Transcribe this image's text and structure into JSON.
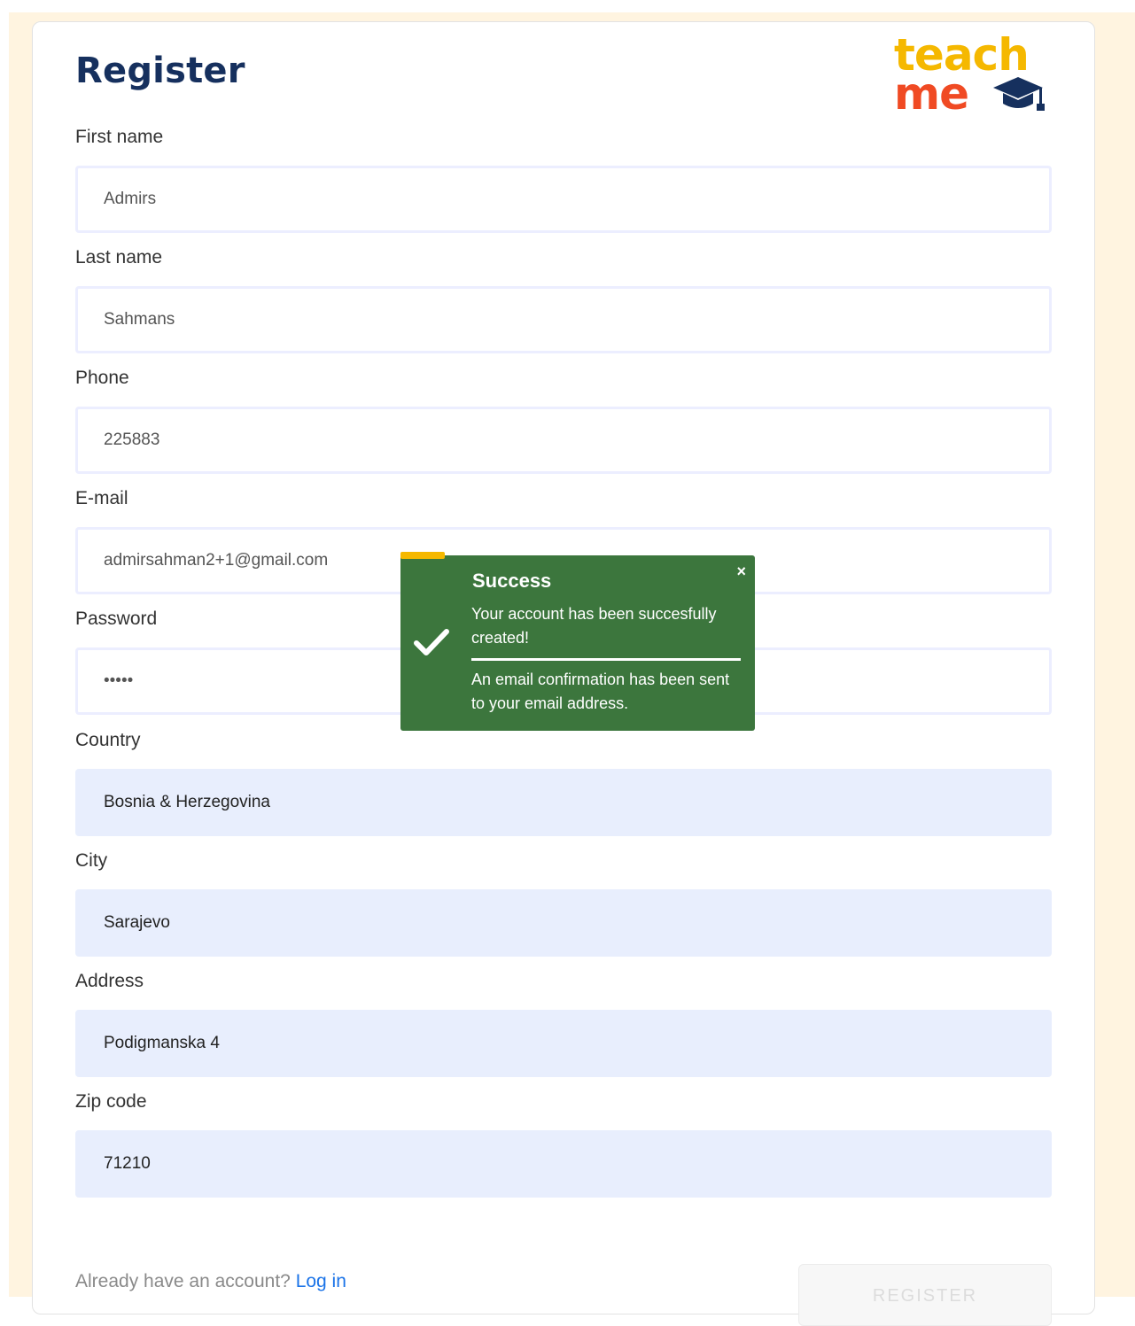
{
  "header": {
    "title": "Register",
    "logo_word_1": "teach",
    "logo_word_2": "me"
  },
  "form": {
    "first_name": {
      "label": "First name",
      "value": "Admirs"
    },
    "last_name": {
      "label": "Last name",
      "value": "Sahmans"
    },
    "phone": {
      "label": "Phone",
      "value": "225883"
    },
    "email": {
      "label": "E-mail",
      "value": "admirsahman2+1@gmail.com"
    },
    "password": {
      "label": "Password",
      "value": "•••••"
    },
    "country": {
      "label": "Country",
      "value": "Bosnia & Herzegovina"
    },
    "city": {
      "label": "City",
      "value": "Sarajevo"
    },
    "address": {
      "label": "Address",
      "value": "Podigmanska 4"
    },
    "zip": {
      "label": "Zip code",
      "value": "71210"
    }
  },
  "footer": {
    "prompt": "Already have an account?",
    "login_link": "Log in",
    "register_button": "REGISTER"
  },
  "toast": {
    "title": "Success",
    "message_1": "Your account has been succesfully created!",
    "message_2": "An email confirmation has been sent to your email address.",
    "close": "×"
  },
  "colors": {
    "title": "#16305e",
    "logo_teach": "#f5b800",
    "logo_me": "#f04a23",
    "toast_bg": "#3c763d",
    "link": "#1a73e8",
    "filled_input": "#e8eefd"
  },
  "icons": {
    "toast_icon": "checkmark-icon",
    "close_icon": "close-icon",
    "logo_icon": "graduation-cap-icon"
  }
}
